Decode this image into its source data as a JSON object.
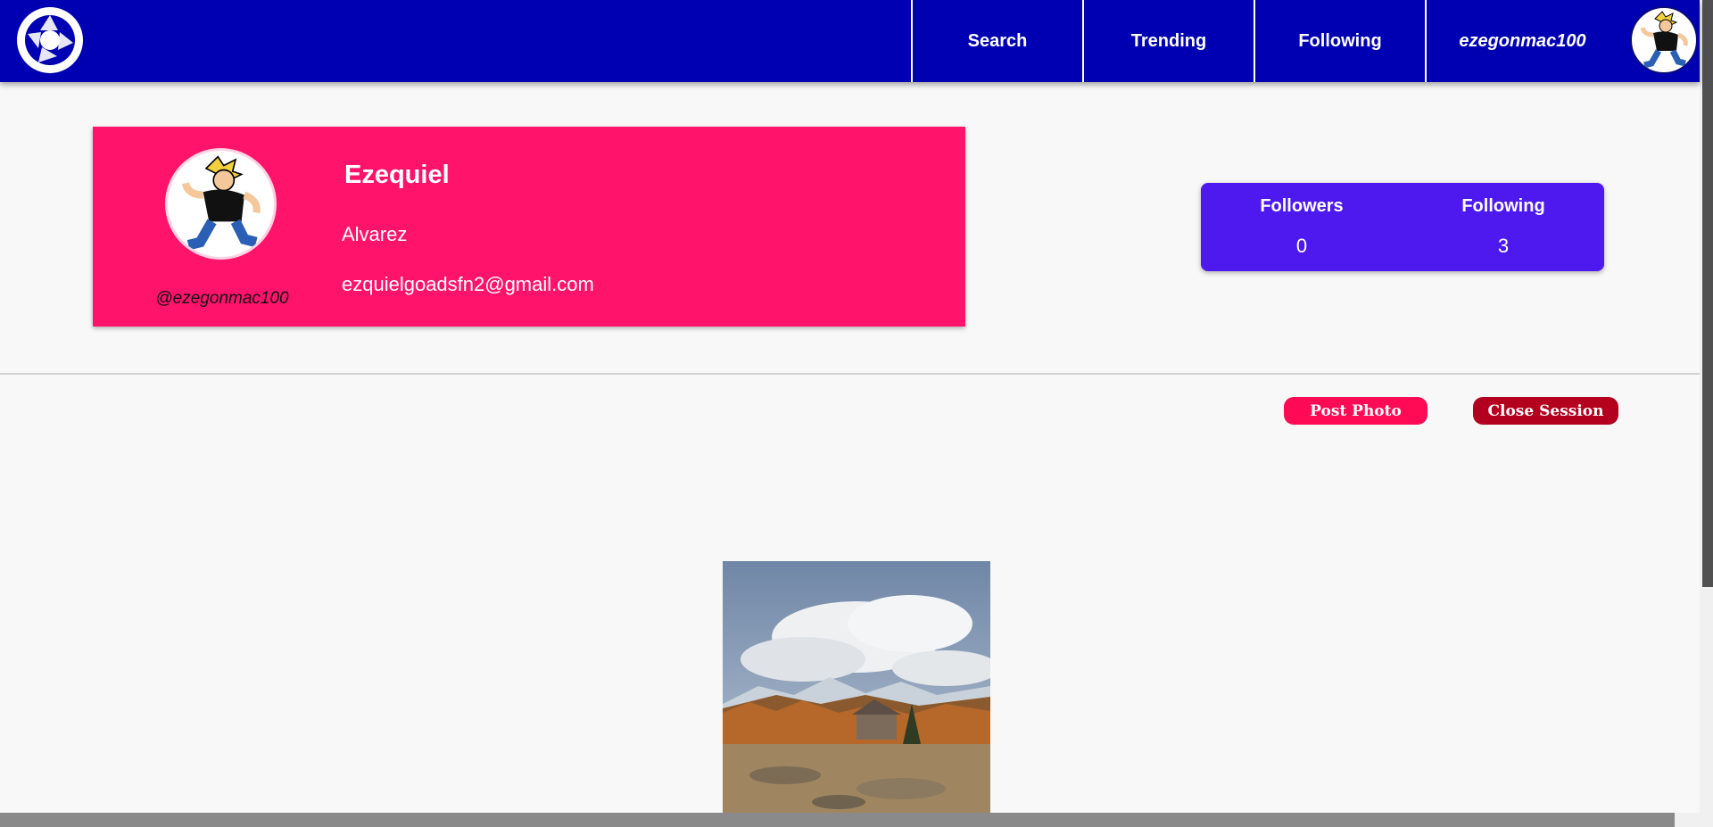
{
  "nav": {
    "logo_icon": "camera-shutter-icon",
    "items": [
      {
        "label": "Search"
      },
      {
        "label": "Trending"
      },
      {
        "label": "Following"
      },
      {
        "label": "ezegonmac100"
      }
    ],
    "avatar_icon": "user-avatar-icon"
  },
  "profile": {
    "first_name": "Ezequiel",
    "last_name": "Alvarez",
    "email": "ezquielgoadsfn2@gmail.com",
    "handle": "@ezegonmac100",
    "avatar_icon": "user-avatar-icon"
  },
  "stats": {
    "followers_label": "Followers",
    "followers_value": "0",
    "following_label": "Following",
    "following_value": "3"
  },
  "actions": {
    "post_photo": "Post Photo",
    "close_session": "Close Session"
  },
  "colors": {
    "navbar": "#0000b3",
    "profile_card": "#ff136b",
    "stats_card": "#4d19ee",
    "post_button": "#ff0b55",
    "close_button": "#b3001e"
  }
}
